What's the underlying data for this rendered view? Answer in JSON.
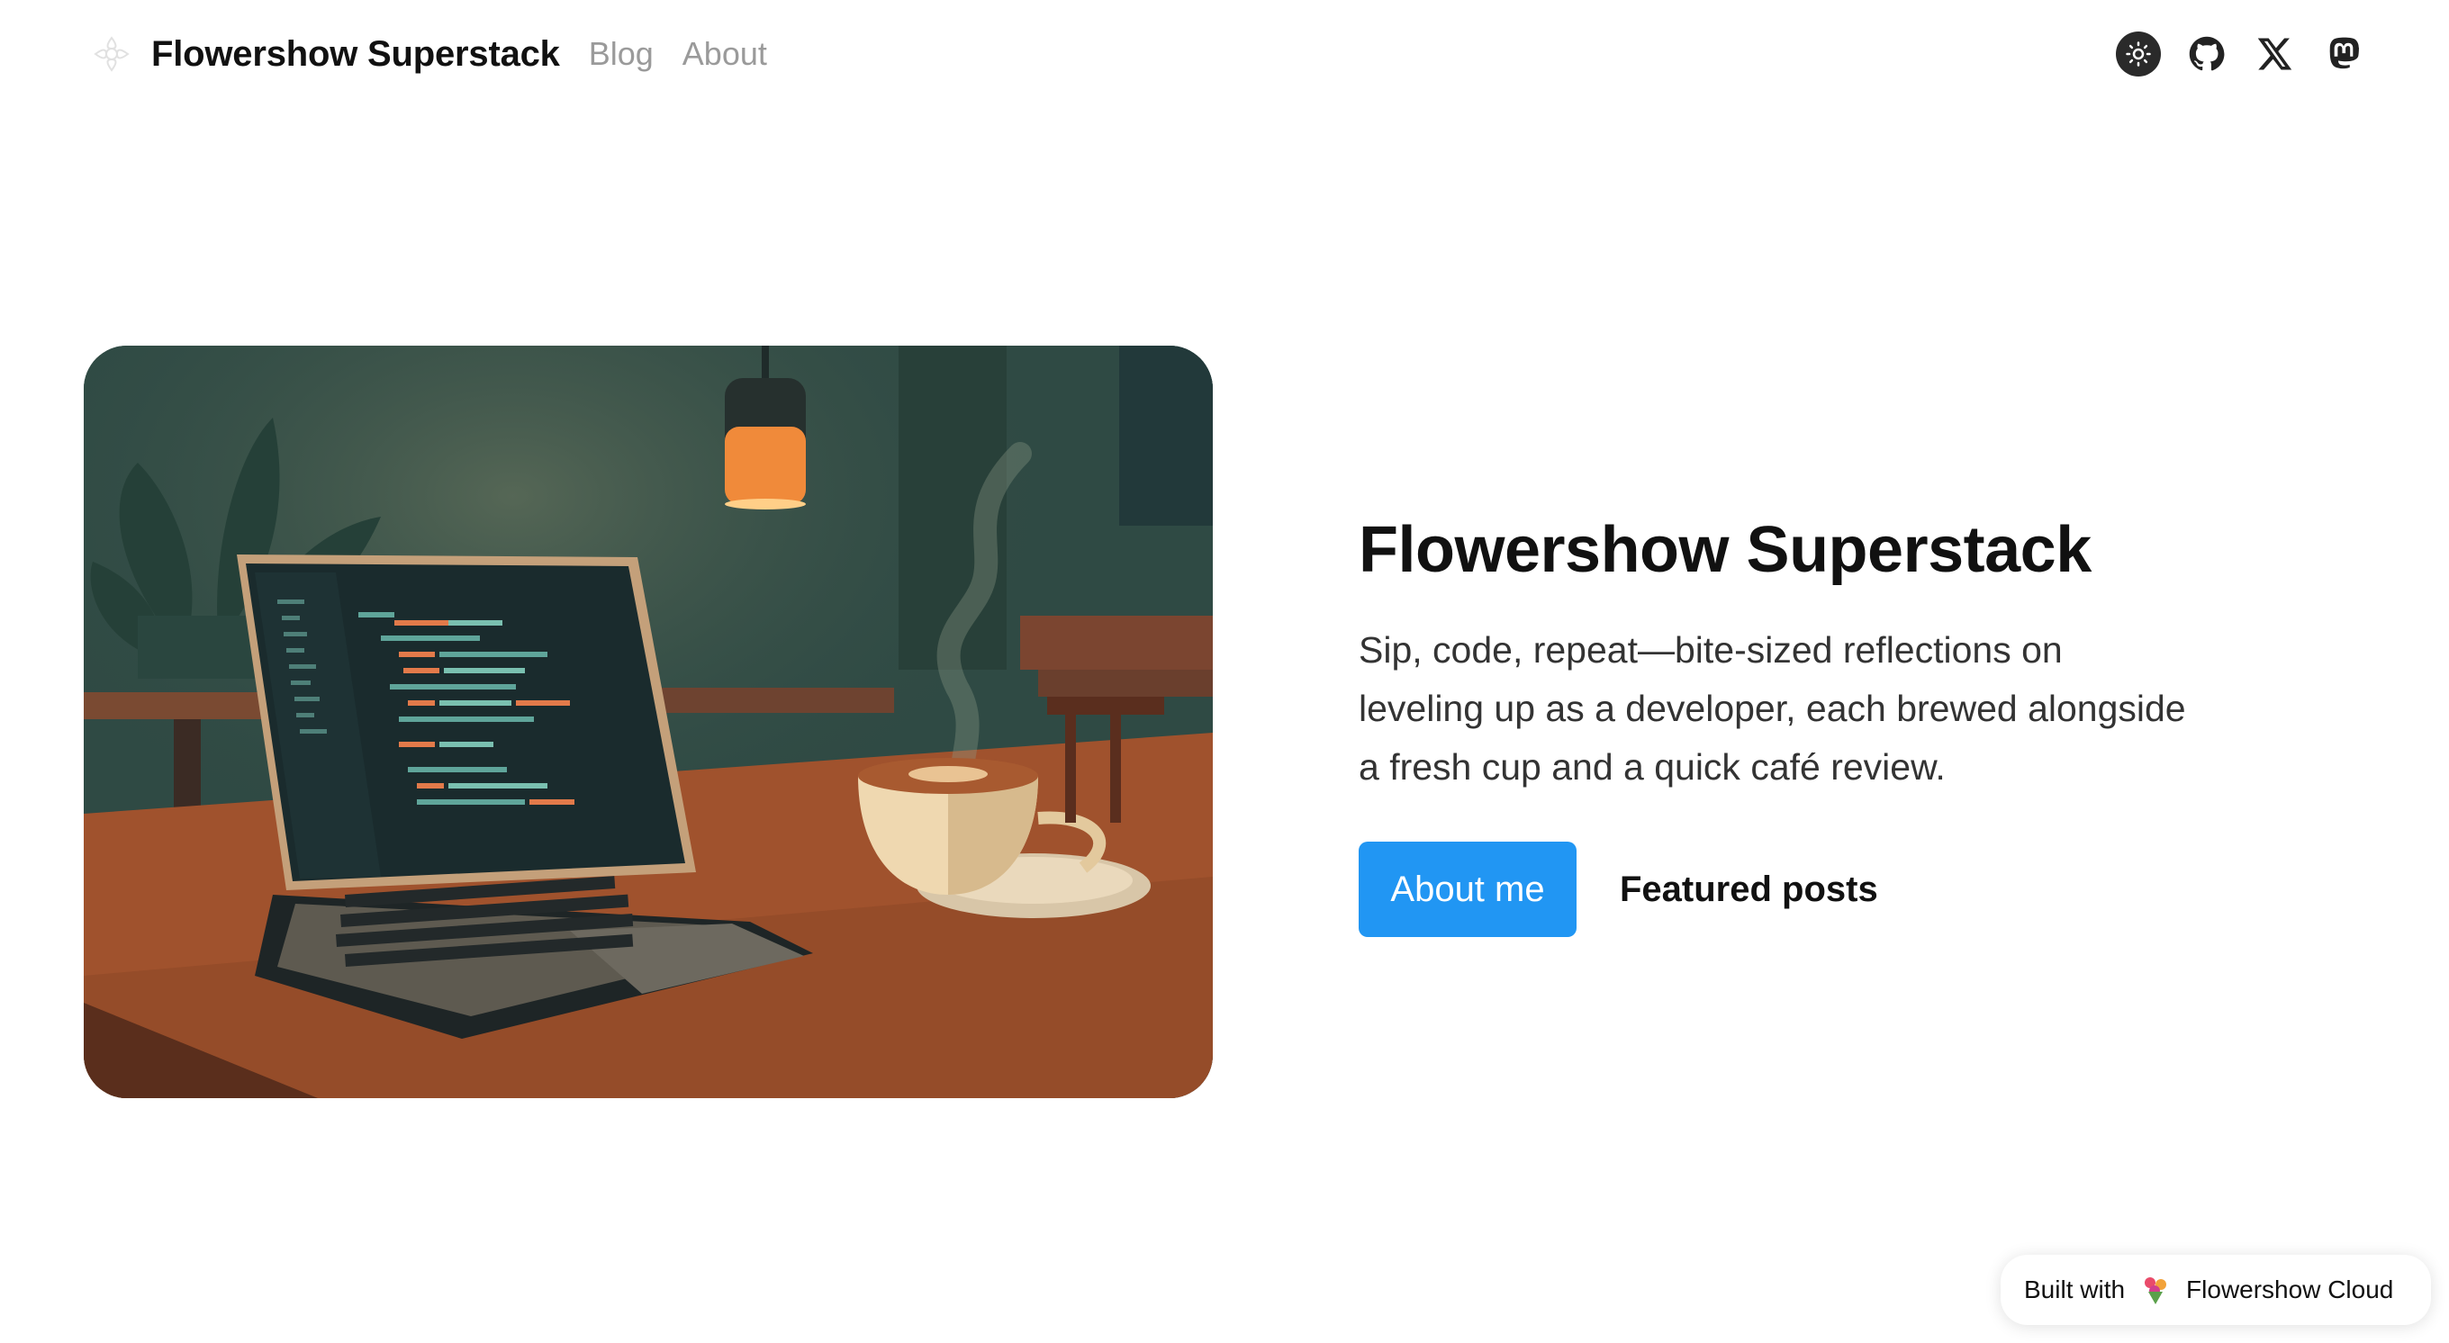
{
  "nav": {
    "site_title": "Flowershow Superstack",
    "links": [
      "Blog",
      "About"
    ]
  },
  "social": {
    "icons": [
      "sun-icon",
      "github-icon",
      "x-icon",
      "mastodon-icon"
    ]
  },
  "hero": {
    "title": "Flowershow Superstack",
    "description": "Sip, code, repeat—bite-sized reflections on leveling up as a developer, each brewed alongside a fresh cup and a quick café review.",
    "primary_button": "About me",
    "secondary_link": "Featured posts"
  },
  "badge": {
    "prefix": "Built with",
    "brand": "Flowershow Cloud"
  },
  "colors": {
    "accent": "#2196f3",
    "nav_link": "#9a9a9a",
    "text": "#111111"
  }
}
